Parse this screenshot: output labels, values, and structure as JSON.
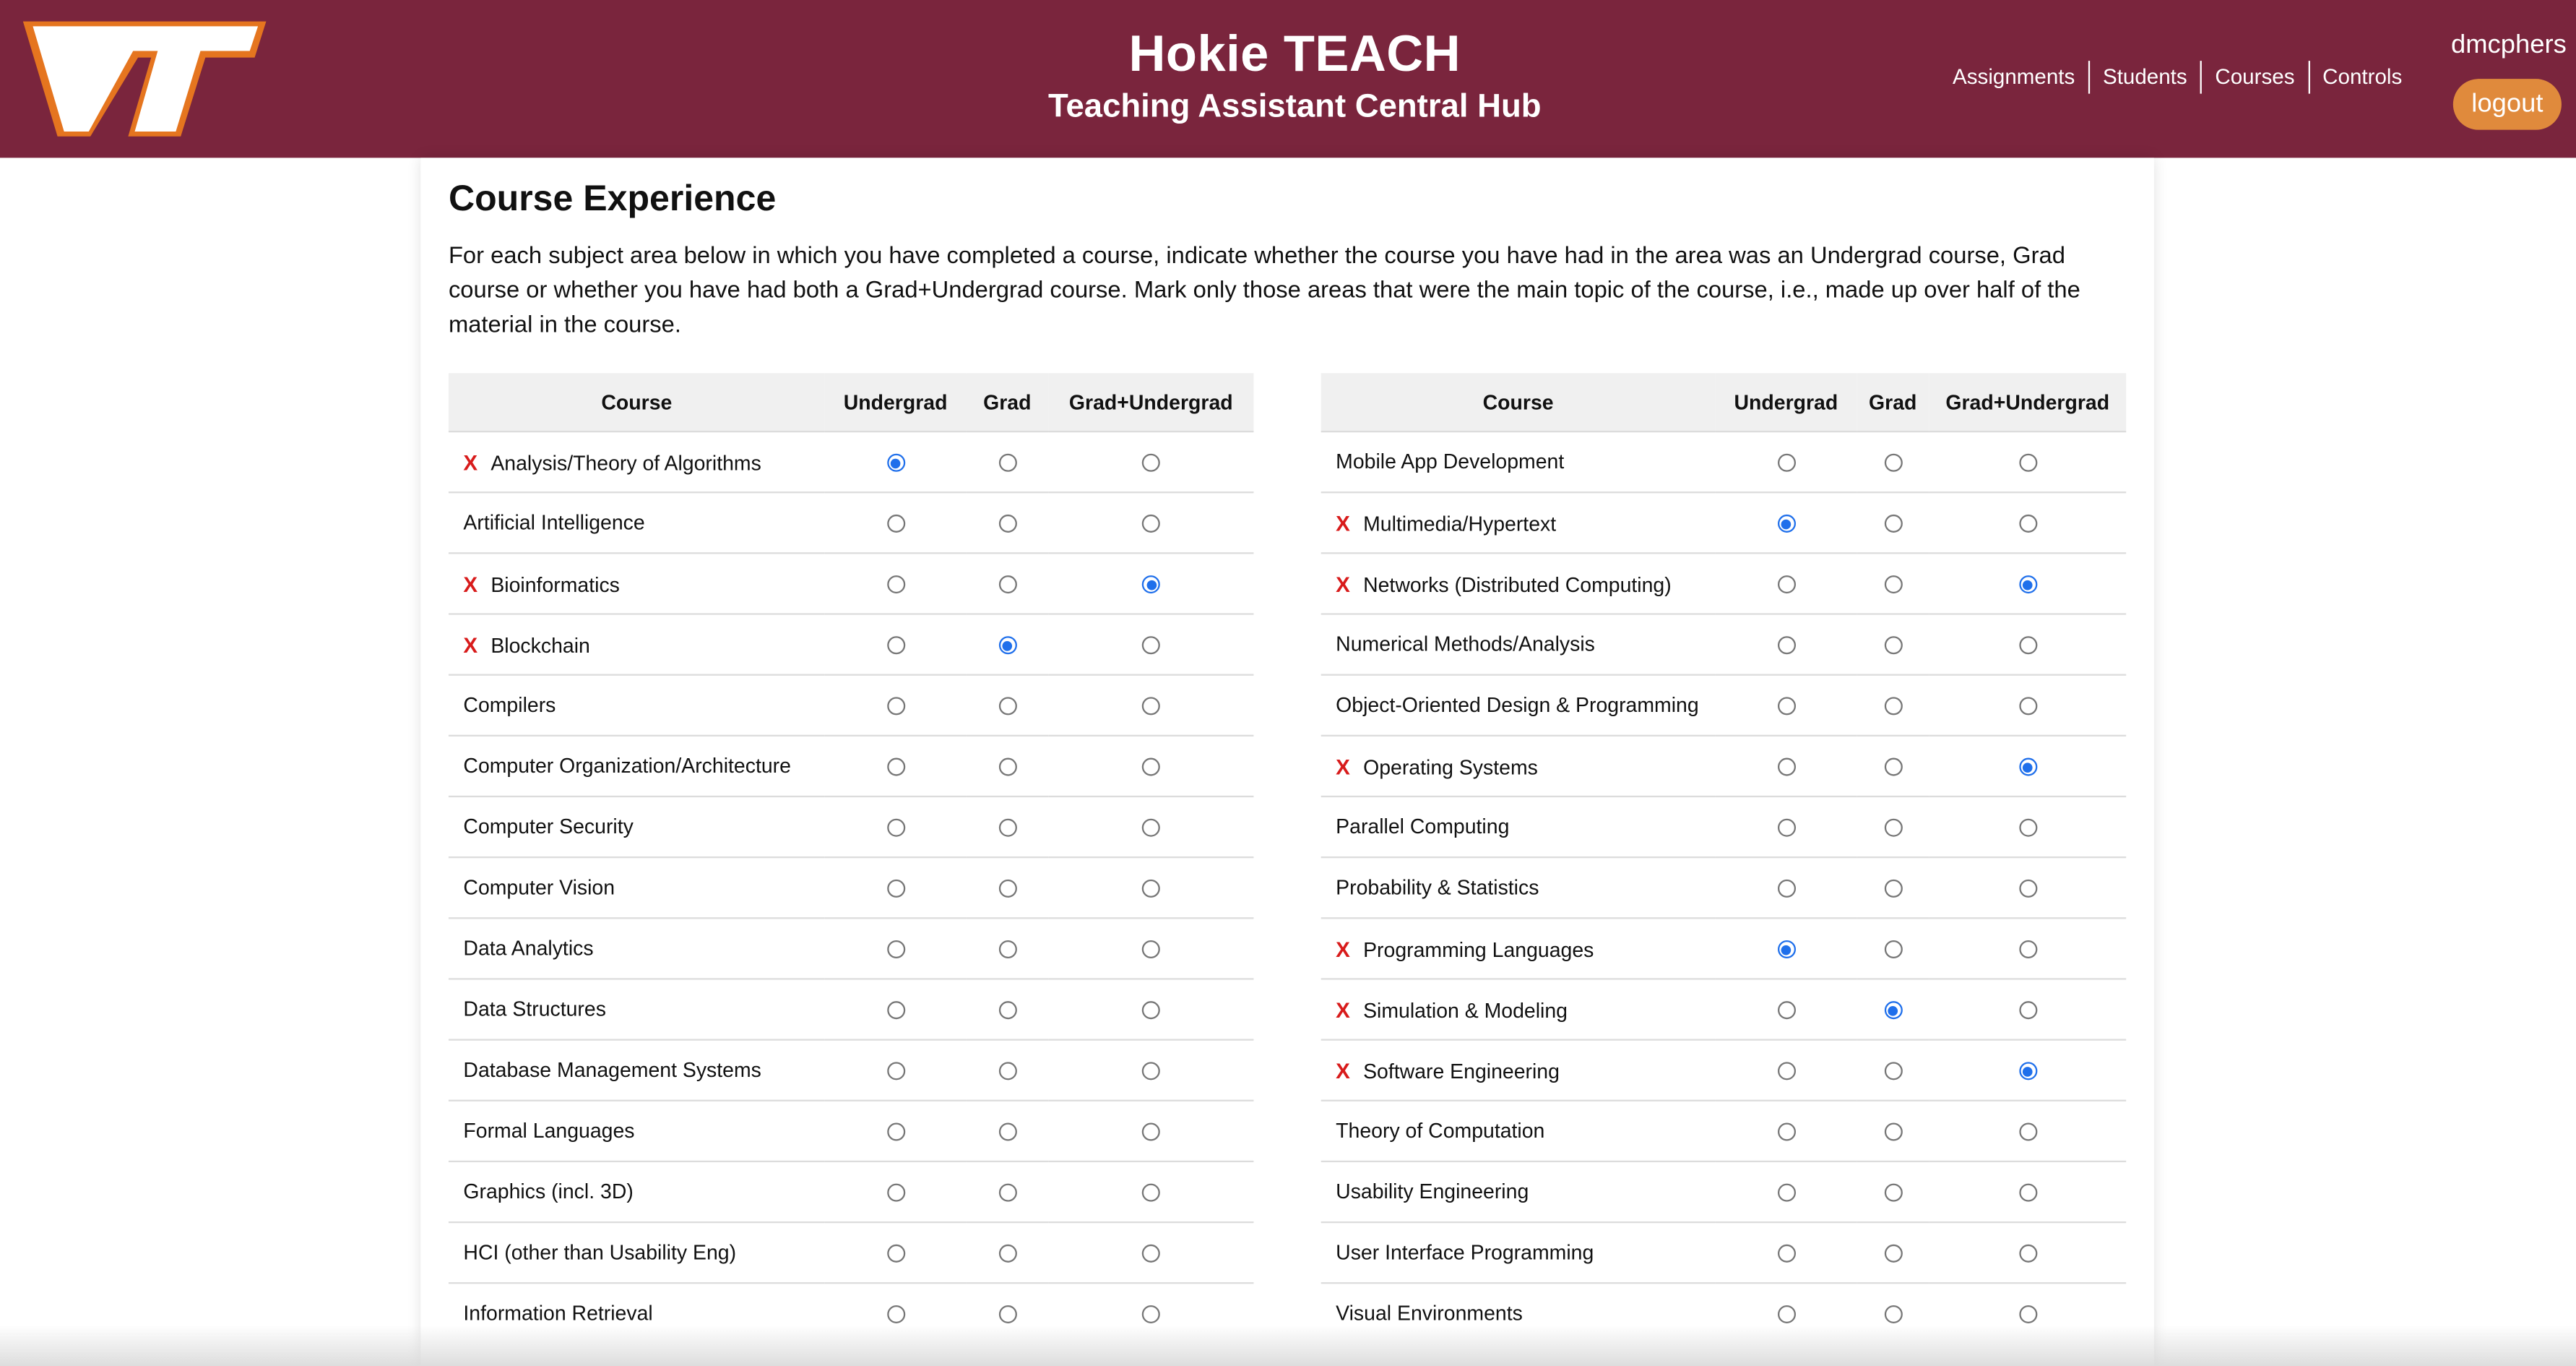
{
  "header": {
    "title": "Hokie TEACH",
    "subtitle": "Teaching Assistant Central Hub",
    "nav": [
      "Assignments",
      "Students",
      "Courses",
      "Controls"
    ],
    "username": "dmcphers",
    "logout": "logout"
  },
  "colors": {
    "maroon": "#7a253d",
    "orange": "#e08a3c",
    "radio_selected": "#1f6feb",
    "x_mark": "#d81b1b"
  },
  "content": {
    "heading": "Course Experience",
    "description": "For each subject area below in which you have completed a course, indicate whether the course you have had in the area was an Undergrad course, Grad course or whether you have had both a Grad+Undergrad course. Mark only those areas that were the main topic of the course, i.e., made up over half of the material in the course.",
    "columns": [
      "Course",
      "Undergrad",
      "Grad",
      "Grad+Undergrad"
    ],
    "mark_symbol": "X",
    "left_table": [
      {
        "name": "Analysis/Theory of Algorithms",
        "sel": 0
      },
      {
        "name": "Artificial Intelligence",
        "sel": null
      },
      {
        "name": "Bioinformatics",
        "sel": 2
      },
      {
        "name": "Blockchain",
        "sel": 1
      },
      {
        "name": "Compilers",
        "sel": null
      },
      {
        "name": "Computer Organization/Architecture",
        "sel": null
      },
      {
        "name": "Computer Security",
        "sel": null
      },
      {
        "name": "Computer Vision",
        "sel": null
      },
      {
        "name": "Data Analytics",
        "sel": null
      },
      {
        "name": "Data Structures",
        "sel": null
      },
      {
        "name": "Database Management Systems",
        "sel": null
      },
      {
        "name": "Formal Languages",
        "sel": null
      },
      {
        "name": "Graphics (incl. 3D)",
        "sel": null
      },
      {
        "name": "HCI (other than Usability Eng)",
        "sel": null
      },
      {
        "name": "Information Retrieval",
        "sel": null
      }
    ],
    "right_table": [
      {
        "name": "Mobile App Development",
        "sel": null
      },
      {
        "name": "Multimedia/Hypertext",
        "sel": 0
      },
      {
        "name": "Networks (Distributed Computing)",
        "sel": 2
      },
      {
        "name": "Numerical Methods/Analysis",
        "sel": null
      },
      {
        "name": "Object-Oriented Design & Programming",
        "sel": null
      },
      {
        "name": "Operating Systems",
        "sel": 2
      },
      {
        "name": "Parallel Computing",
        "sel": null
      },
      {
        "name": "Probability & Statistics",
        "sel": null
      },
      {
        "name": "Programming Languages",
        "sel": 0
      },
      {
        "name": "Simulation & Modeling",
        "sel": 1
      },
      {
        "name": "Software Engineering",
        "sel": 2
      },
      {
        "name": "Theory of Computation",
        "sel": null
      },
      {
        "name": "Usability Engineering",
        "sel": null
      },
      {
        "name": "User Interface Programming",
        "sel": null
      },
      {
        "name": "Visual Environments",
        "sel": null
      }
    ]
  }
}
